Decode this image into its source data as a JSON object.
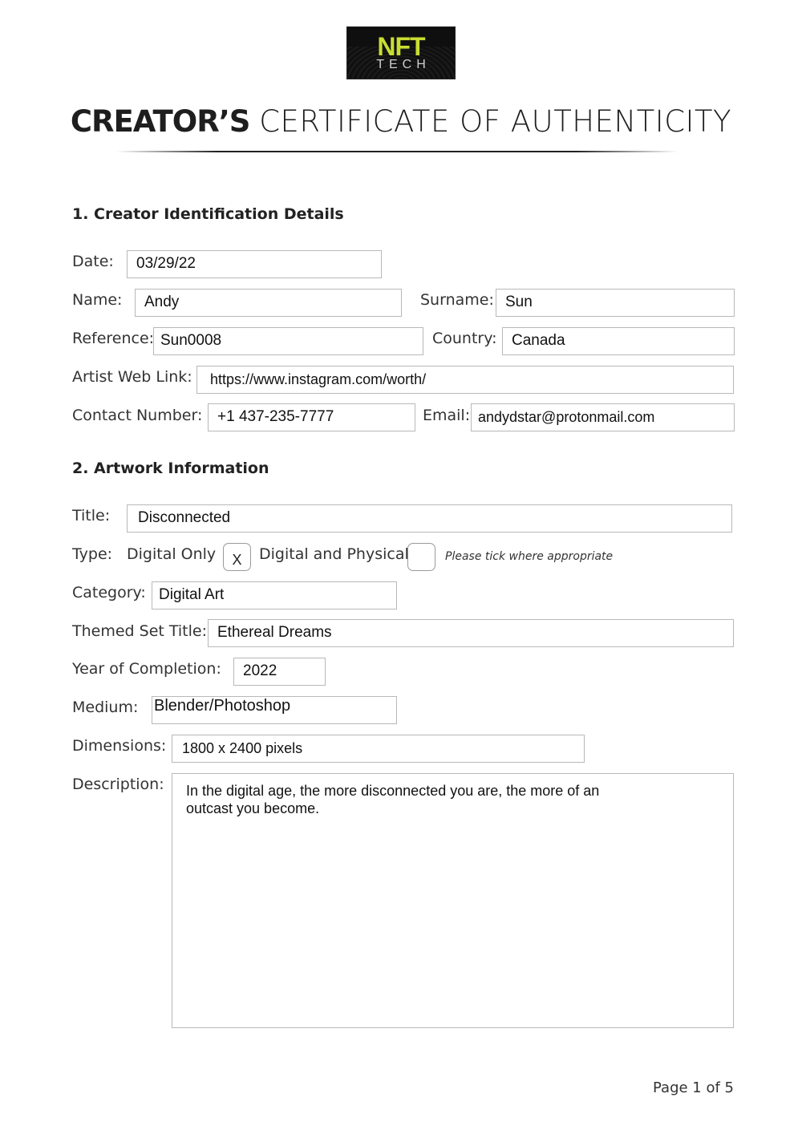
{
  "logo": {
    "main": "NFT",
    "sub": "TECH",
    "accent_color": "#c9de32"
  },
  "header": {
    "title_bold": "CREATOR’S",
    "title_light": "CERTIFICATE OF AUTHENTICITY"
  },
  "section1": {
    "heading": "1. Creator Identification Details",
    "date": {
      "label": "Date:",
      "value": "03/29/22"
    },
    "name": {
      "label": "Name:",
      "value": "Andy"
    },
    "surname": {
      "label": "Surname:",
      "value": "Sun"
    },
    "reference": {
      "label": "Reference:",
      "value": "Sun0008"
    },
    "country": {
      "label": "Country:",
      "value": "Canada"
    },
    "web_link": {
      "label": "Artist Web Link:",
      "value": "https://www.instagram.com/worth/"
    },
    "contact": {
      "label": "Contact Number:",
      "value": "+1 437-235-7777"
    },
    "email": {
      "label": "Email:",
      "value": "andydstar@protonmail.com"
    }
  },
  "section2": {
    "heading": "2. Artwork Information",
    "title": {
      "label": "Title:",
      "value": "Disconnected"
    },
    "type": {
      "label": "Type:",
      "options": [
        {
          "label": "Digital Only",
          "mark": "X",
          "checked": true
        },
        {
          "label": "Digital and Physical",
          "mark": "",
          "checked": false
        }
      ],
      "hint": "Please tick where appropriate"
    },
    "category": {
      "label": "Category:",
      "value": "Digital Art"
    },
    "themed_set": {
      "label": "Themed Set Title:",
      "value": "Ethereal Dreams"
    },
    "year": {
      "label": "Year of Completion:",
      "value": "2022"
    },
    "medium": {
      "label": "Medium:",
      "value": "Blender/Photoshop"
    },
    "dimensions": {
      "label": "Dimensions:",
      "value": "1800 x 2400 pixels"
    },
    "description": {
      "label": "Description:",
      "value": "In the digital age, the more disconnected you are, the more of an outcast you become."
    }
  },
  "footer": {
    "page": "Page 1 of 5"
  }
}
